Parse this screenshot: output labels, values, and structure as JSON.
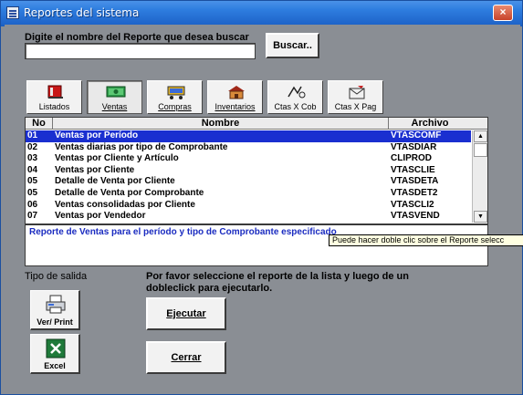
{
  "window": {
    "title": "Reportes del sistema",
    "close_glyph": "×"
  },
  "search": {
    "label": "Digite el nombre del Reporte que desea buscar",
    "value": "",
    "button": "Buscar.."
  },
  "tabs": [
    {
      "label": "Listados",
      "icon": "book-icon"
    },
    {
      "label": "Ventas",
      "icon": "money-icon"
    },
    {
      "label": "Compras",
      "icon": "cart-icon"
    },
    {
      "label": "Inventarios",
      "icon": "warehouse-icon"
    },
    {
      "label": "Ctas X Cob",
      "icon": "calculator-icon"
    },
    {
      "label": "Ctas X Pag",
      "icon": "envelope-icon"
    }
  ],
  "grid": {
    "headers": {
      "no": "No",
      "nombre": "Nombre",
      "archivo": "Archivo"
    },
    "rows": [
      {
        "no": "01",
        "nombre": "Ventas por Período",
        "archivo": "VTASCOMF"
      },
      {
        "no": "02",
        "nombre": "Ventas diarias por tipo de Comprobante",
        "archivo": "VTASDIAR"
      },
      {
        "no": "03",
        "nombre": "Ventas por Cliente y Artículo",
        "archivo": "CLIPROD"
      },
      {
        "no": "04",
        "nombre": "Ventas por Cliente",
        "archivo": "VTASCLIE"
      },
      {
        "no": "05",
        "nombre": "Detalle de Venta por Cliente",
        "archivo": "VTASDETA"
      },
      {
        "no": "05",
        "nombre": "Detalle de Venta por Comprobante",
        "archivo": "VTASDET2"
      },
      {
        "no": "06",
        "nombre": "Ventas consolidadas por Cliente",
        "archivo": "VTASCLI2"
      },
      {
        "no": "07",
        "nombre": "Ventas por Vendedor",
        "archivo": "VTASVEND"
      }
    ]
  },
  "description": "Reporte de Ventas para el período y tipo de Comprobante especificado",
  "tooltip": "Puede hacer doble clic sobre el Reporte selecc",
  "output": {
    "label": "Tipo de salida",
    "print_label": "Ver/ Print",
    "excel_label": "Excel"
  },
  "instructions": "Por favor seleccione el reporte de la lista y luego de un dobleclick para ejecutarlo.",
  "actions": {
    "execute": "Ejecutar",
    "close": "Cerrar"
  }
}
